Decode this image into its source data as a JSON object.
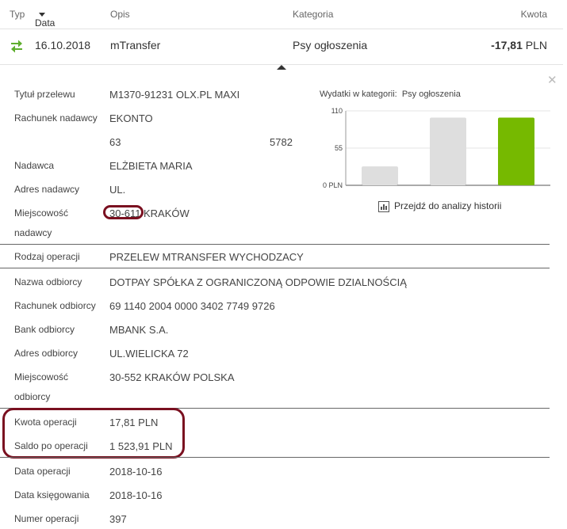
{
  "header": {
    "typ": "Typ",
    "data": "Data",
    "opis": "Opis",
    "kategoria": "Kategoria",
    "kwota": "Kwota"
  },
  "transaction": {
    "icon": "transfer-arrows-icon",
    "date": "16.10.2018",
    "opis": "mTransfer",
    "kategoria": "Psy ogłoszenia",
    "kwota": "-17,81",
    "currency": "PLN"
  },
  "details": {
    "tytul_label": "Tytuł przelewu",
    "tytul": "M1370-91231 OLX.PL MAXI",
    "rach_nad_label": "Rachunek nadawcy",
    "rach_nad_1": "EKONTO",
    "rach_nad_2a": "63",
    "rach_nad_2b": "5782",
    "nadawca_label": "Nadawca",
    "nadawca": "ELŻBIETA MARIA",
    "adres_nad_label": "Adres nadawcy",
    "adres_nad": "UL.",
    "miejsc_nad_label_1": "Miejscowość",
    "miejsc_nad_label_2": "nadawcy",
    "miejsc_nad_code": "30-611",
    "miejsc_nad": "KRAKÓW",
    "rodzaj_label": "Rodzaj operacji",
    "rodzaj": "PRZELEW MTRANSFER WYCHODZACY",
    "nazwa_odb_label": "Nazwa odbiorcy",
    "nazwa_odb": "DOTPAY SPÓŁKA Z OGRANICZONĄ ODPOWIE DZIALNOŚCIĄ",
    "rach_odb_label": "Rachunek odbiorcy",
    "rach_odb": "69 1140 2004 0000 3402 7749 9726",
    "bank_odb_label": "Bank odbiorcy",
    "bank_odb": "MBANK S.A.",
    "adres_odb_label": "Adres odbiorcy",
    "adres_odb": "UL.WIELICKA 72",
    "miejsc_odb_label_1": "Miejscowość",
    "miejsc_odb_label_2": "odbiorcy",
    "miejsc_odb": "30-552 KRAKÓW POLSKA",
    "kwota_op_label": "Kwota operacji",
    "kwota_op": "17,81 PLN",
    "saldo_label": "Saldo po operacji",
    "saldo": "1 523,91 PLN",
    "data_op_label": "Data operacji",
    "data_op": "2018-10-16",
    "data_ksieg_label": "Data księgowania",
    "data_ksieg": "2018-10-16",
    "numer_label": "Numer operacji",
    "numer": "397"
  },
  "chart_title_prefix": "Wydatki w kategorii:",
  "chart_title_category": "Psy ogłoszenia",
  "analysis_link": "Przejdź do analizy historii",
  "close_icon": "close-icon",
  "colors": {
    "accent_green": "#76b900",
    "bar_grey": "#dedede",
    "highlight": "#7a1020"
  },
  "chart_data": {
    "type": "bar",
    "categories": [
      "",
      "",
      ""
    ],
    "values": [
      28,
      100,
      100
    ],
    "colors": [
      "#dedede",
      "#dedede",
      "#76b900"
    ],
    "yticks": [
      "110",
      "55",
      "0 PLN"
    ],
    "ylim": [
      0,
      110
    ],
    "grid": true
  }
}
